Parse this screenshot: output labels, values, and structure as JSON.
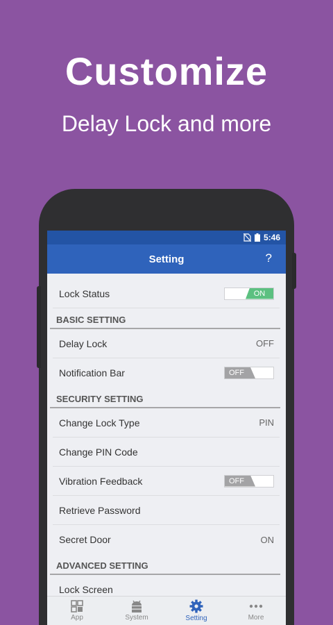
{
  "hero": {
    "title": "Customize",
    "subtitle": "Delay Lock and more"
  },
  "status_bar": {
    "time": "5:46",
    "icons": [
      "no-sim-icon",
      "battery-icon"
    ]
  },
  "app_bar": {
    "title": "Setting",
    "help_label": "?"
  },
  "settings": {
    "lock_status": {
      "label": "Lock Status",
      "toggle": "ON"
    },
    "basic_header": "BASIC SETTING",
    "delay_lock": {
      "label": "Delay Lock",
      "value": "OFF"
    },
    "notification_bar": {
      "label": "Notification Bar",
      "toggle": "OFF"
    },
    "security_header": "SECURITY SETTING",
    "change_lock_type": {
      "label": "Change Lock Type",
      "value": "PIN"
    },
    "change_pin": {
      "label": "Change PIN Code"
    },
    "vibration": {
      "label": "Vibration Feedback",
      "toggle": "OFF"
    },
    "retrieve_password": {
      "label": "Retrieve Password"
    },
    "secret_door": {
      "label": "Secret Door",
      "value": "ON"
    },
    "advanced_header": "ADVANCED SETTING",
    "lock_screen": {
      "label": "Lock Screen"
    }
  },
  "bottom_nav": {
    "app": "App",
    "system": "System",
    "setting": "Setting",
    "more": "More",
    "active": "Setting"
  },
  "colors": {
    "background": "#8b54a1",
    "app_bar": "#2f63bb",
    "status_bar": "#2354a5",
    "toggle_on": "#5cc080",
    "toggle_off": "#a3a3a5"
  }
}
